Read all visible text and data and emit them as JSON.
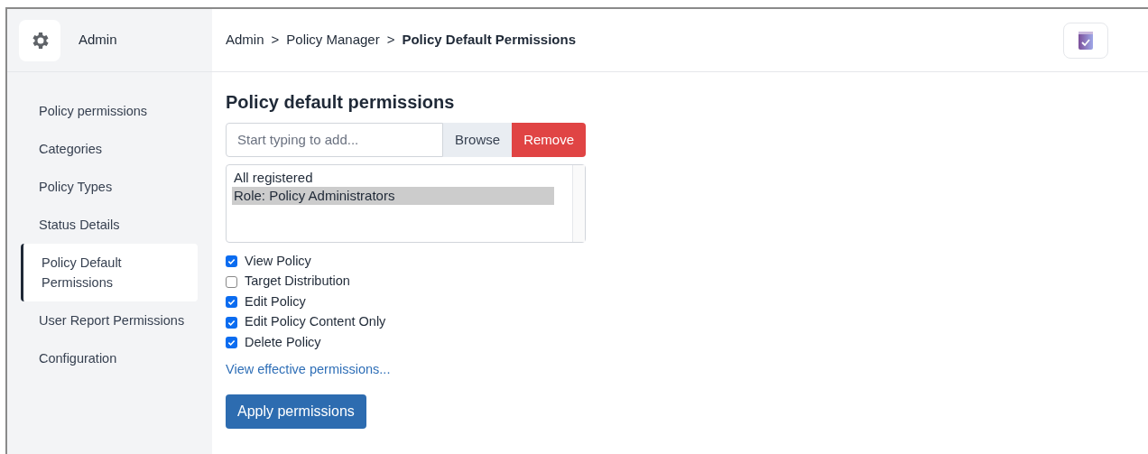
{
  "app": {
    "title": "Admin"
  },
  "sidebar": {
    "items": [
      {
        "label": "Policy permissions",
        "selected": false
      },
      {
        "label": "Categories",
        "selected": false
      },
      {
        "label": "Policy Types",
        "selected": false
      },
      {
        "label": "Status Details",
        "selected": false
      },
      {
        "label": "Policy Default Permissions",
        "selected": true
      },
      {
        "label": "User Report Permissions",
        "selected": false
      },
      {
        "label": "Configuration",
        "selected": false
      }
    ]
  },
  "breadcrumb": {
    "items": [
      "Admin",
      "Policy Manager"
    ],
    "separator": ">",
    "current": "Policy Default Permissions"
  },
  "main": {
    "heading": "Policy default permissions",
    "search": {
      "placeholder": "Start typing to add..."
    },
    "buttons": {
      "browse": "Browse",
      "remove": "Remove"
    },
    "principals": [
      {
        "label": "All registered",
        "selected": false
      },
      {
        "label": "Role: Policy Administrators",
        "selected": true
      }
    ],
    "permissions": [
      {
        "label": "View Policy",
        "checked": true
      },
      {
        "label": "Target Distribution",
        "checked": false
      },
      {
        "label": "Edit Policy",
        "checked": true
      },
      {
        "label": "Edit Policy Content Only",
        "checked": true
      },
      {
        "label": "Delete Policy",
        "checked": true
      }
    ],
    "link": "View effective permissions...",
    "apply": "Apply permissions"
  }
}
